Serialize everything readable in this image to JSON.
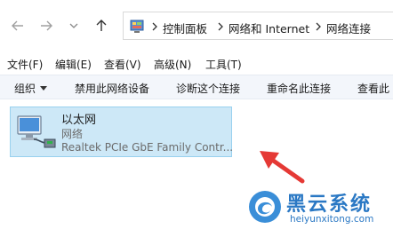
{
  "breadcrumb": {
    "items": [
      "控制面板",
      "网络和 Internet",
      "网络连接"
    ]
  },
  "menu": {
    "items": [
      "文件(F)",
      "编辑(E)",
      "查看(V)",
      "高级(N)",
      "工具(T)"
    ]
  },
  "commands": {
    "organize": "组织",
    "items": [
      "禁用此网络设备",
      "诊断这个连接",
      "重命名此连接",
      "查看此"
    ]
  },
  "connection": {
    "name": "以太网",
    "type": "网络",
    "device": "Realtek PCIe GbE Family Contr..."
  },
  "watermark": {
    "title": "黑云系统",
    "url": "heiyunxitong.com"
  },
  "colors": {
    "selection_bg": "#cde8f7",
    "selection_border": "#99d1ef",
    "arrow": "#e53935",
    "watermark": "#2a78c4"
  }
}
